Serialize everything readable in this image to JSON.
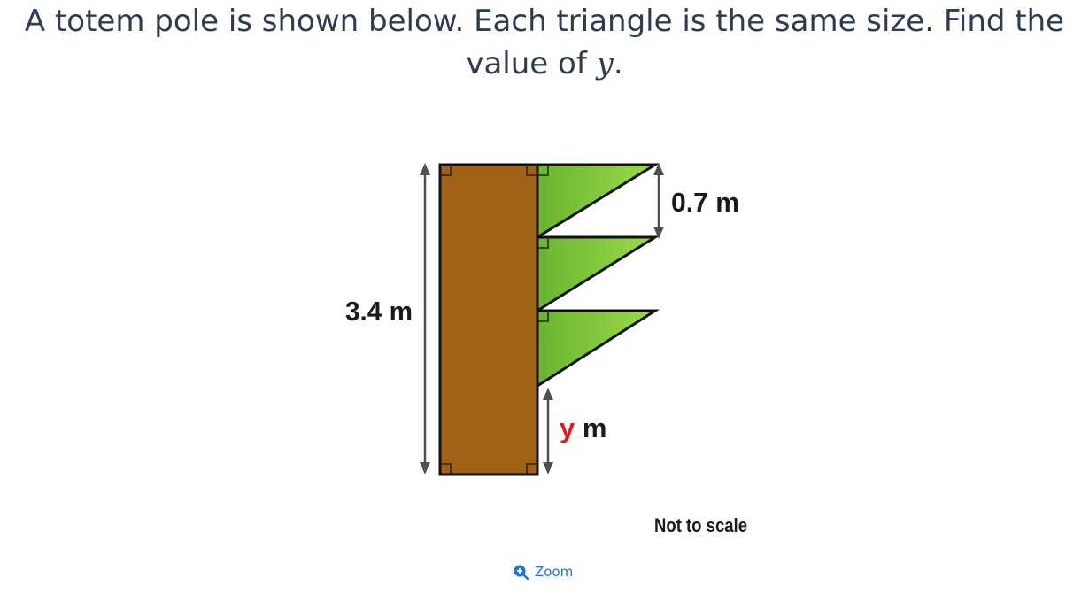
{
  "question": {
    "text_before": "A totem pole is shown below. Each triangle is the same size. Find the value of ",
    "variable": "y",
    "text_after": "."
  },
  "diagram": {
    "labels": {
      "total_height": "3.4 m",
      "triangle_height": "0.7 m",
      "y_var": "y",
      "y_unit": " m",
      "note": "Not to scale"
    },
    "triangle_count": 3,
    "colors": {
      "pole": "#a16218",
      "triangle": "#7ec93a",
      "arrow": "#505050",
      "outline": "#111111"
    }
  },
  "zoom": {
    "label": "Zoom",
    "icon": "zoom-in-icon"
  }
}
